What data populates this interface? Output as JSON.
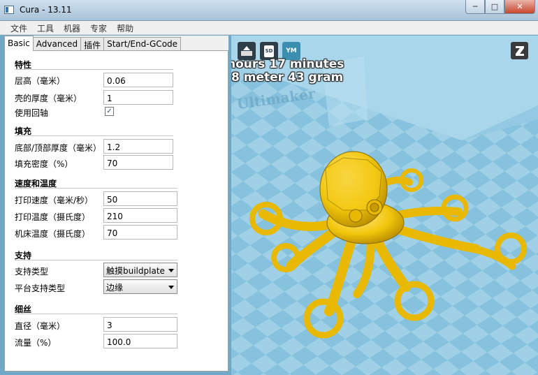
{
  "window": {
    "title": "Cura - 13.11",
    "min_label": "─",
    "max_label": "□",
    "close_label": "✕"
  },
  "menu": [
    "文件",
    "工具",
    "机器",
    "专家",
    "帮助"
  ],
  "tabs": [
    "Basic",
    "Advanced",
    "插件",
    "Start/End-GCode"
  ],
  "sections": {
    "quality": {
      "title": "特性",
      "layer_height_label": "层高（毫米）",
      "layer_height": "0.06",
      "shell_label": "壳的厚度（毫米）",
      "shell": "1",
      "retraction_label": "使用回轴",
      "retraction_checked": "✓"
    },
    "fill": {
      "title": "填充",
      "bottom_top_label": "底部/顶部厚度（毫米）",
      "bottom_top": "1.2",
      "density_label": "填充密度（%）",
      "density": "70"
    },
    "speed": {
      "title": "速度和温度",
      "print_speed_label": "打印速度（毫米/秒）",
      "print_speed": "50",
      "print_temp_label": "打印温度（摄氏度）",
      "print_temp": "210",
      "bed_temp_label": "机床温度（摄氏度）",
      "bed_temp": "70"
    },
    "support": {
      "title": "支持",
      "type_label": "支持类型",
      "type_value": "触摸buildplate",
      "adhesion_label": "平台支持类型",
      "adhesion_value": "边缘"
    },
    "filament": {
      "title": "细丝",
      "diameter_label": "直径（毫米）",
      "diameter": "3",
      "flow_label": "流量（%）",
      "flow": "100.0"
    }
  },
  "viewport": {
    "load_icon": "load-icon",
    "sd_label": "SD",
    "ym_label": "YM",
    "print_time": "hours 17 minutes",
    "material": "8 meter 43 gram",
    "brand": "Ultimaker",
    "colors": {
      "plate": "#9fd0e6",
      "model": "#f2c60c"
    }
  }
}
